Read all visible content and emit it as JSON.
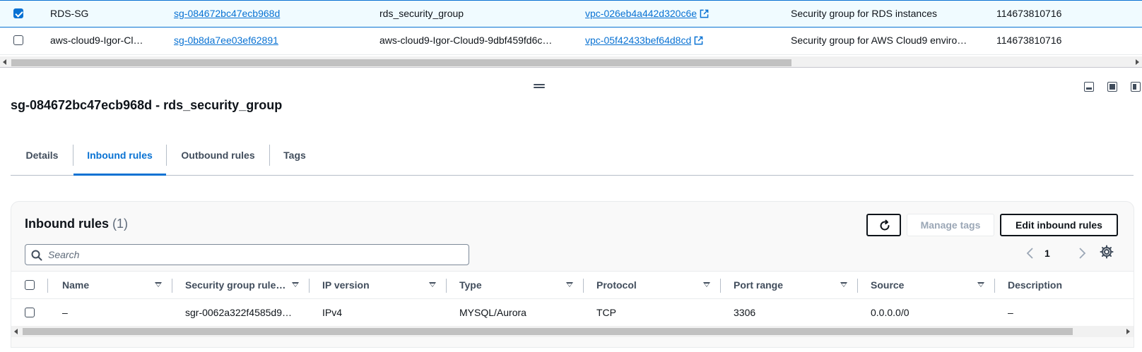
{
  "top_table": {
    "rows": [
      {
        "selected": true,
        "name": "RDS-SG",
        "group_id": "sg-084672bc47ecb968d",
        "group_name": "rds_security_group",
        "vpc_id": "vpc-026eb4a442d320c6e",
        "description": "Security group for RDS instances",
        "owner": "114673810716"
      },
      {
        "selected": false,
        "name": "aws-cloud9-Igor-Cl…",
        "group_id": "sg-0b8da7ee03ef62891",
        "group_name": "aws-cloud9-Igor-Cloud9-9dbf459fd6c…",
        "vpc_id": "vpc-05f42433bef64d8cd",
        "description": "Security group for AWS Cloud9 enviro…",
        "owner": "114673810716"
      }
    ]
  },
  "panel": {
    "title": "sg-084672bc47ecb968d - rds_security_group",
    "tabs": [
      {
        "label": "Details",
        "active": false
      },
      {
        "label": "Inbound rules",
        "active": true
      },
      {
        "label": "Outbound rules",
        "active": false
      },
      {
        "label": "Tags",
        "active": false
      }
    ]
  },
  "inbound": {
    "title": "Inbound rules",
    "count": "(1)",
    "buttons": {
      "manage_tags": "Manage tags",
      "edit_rules": "Edit inbound rules"
    },
    "search_placeholder": "Search",
    "page": "1",
    "columns": [
      "Name",
      "Security group rule…",
      "IP version",
      "Type",
      "Protocol",
      "Port range",
      "Source",
      "Description"
    ],
    "rows": [
      {
        "name": "–",
        "rule_id": "sgr-0062a322f4585d9…",
        "ip_version": "IPv4",
        "type": "MYSQL/Aurora",
        "protocol": "TCP",
        "port_range": "3306",
        "source": "0.0.0.0/0",
        "description": "–"
      }
    ]
  },
  "colors": {
    "accent": "#0972d3",
    "selected_row_bg": "#f0fbff",
    "text": "#0f141a",
    "muted": "#5f6b7a"
  },
  "icons": [
    "external-link-icon",
    "drag-handle-icon",
    "panel-bottom-icon",
    "panel-full-icon",
    "panel-side-icon",
    "refresh-icon",
    "search-icon",
    "chevron-left-icon",
    "chevron-right-icon",
    "settings-gear-icon",
    "sort-caret-icon"
  ]
}
